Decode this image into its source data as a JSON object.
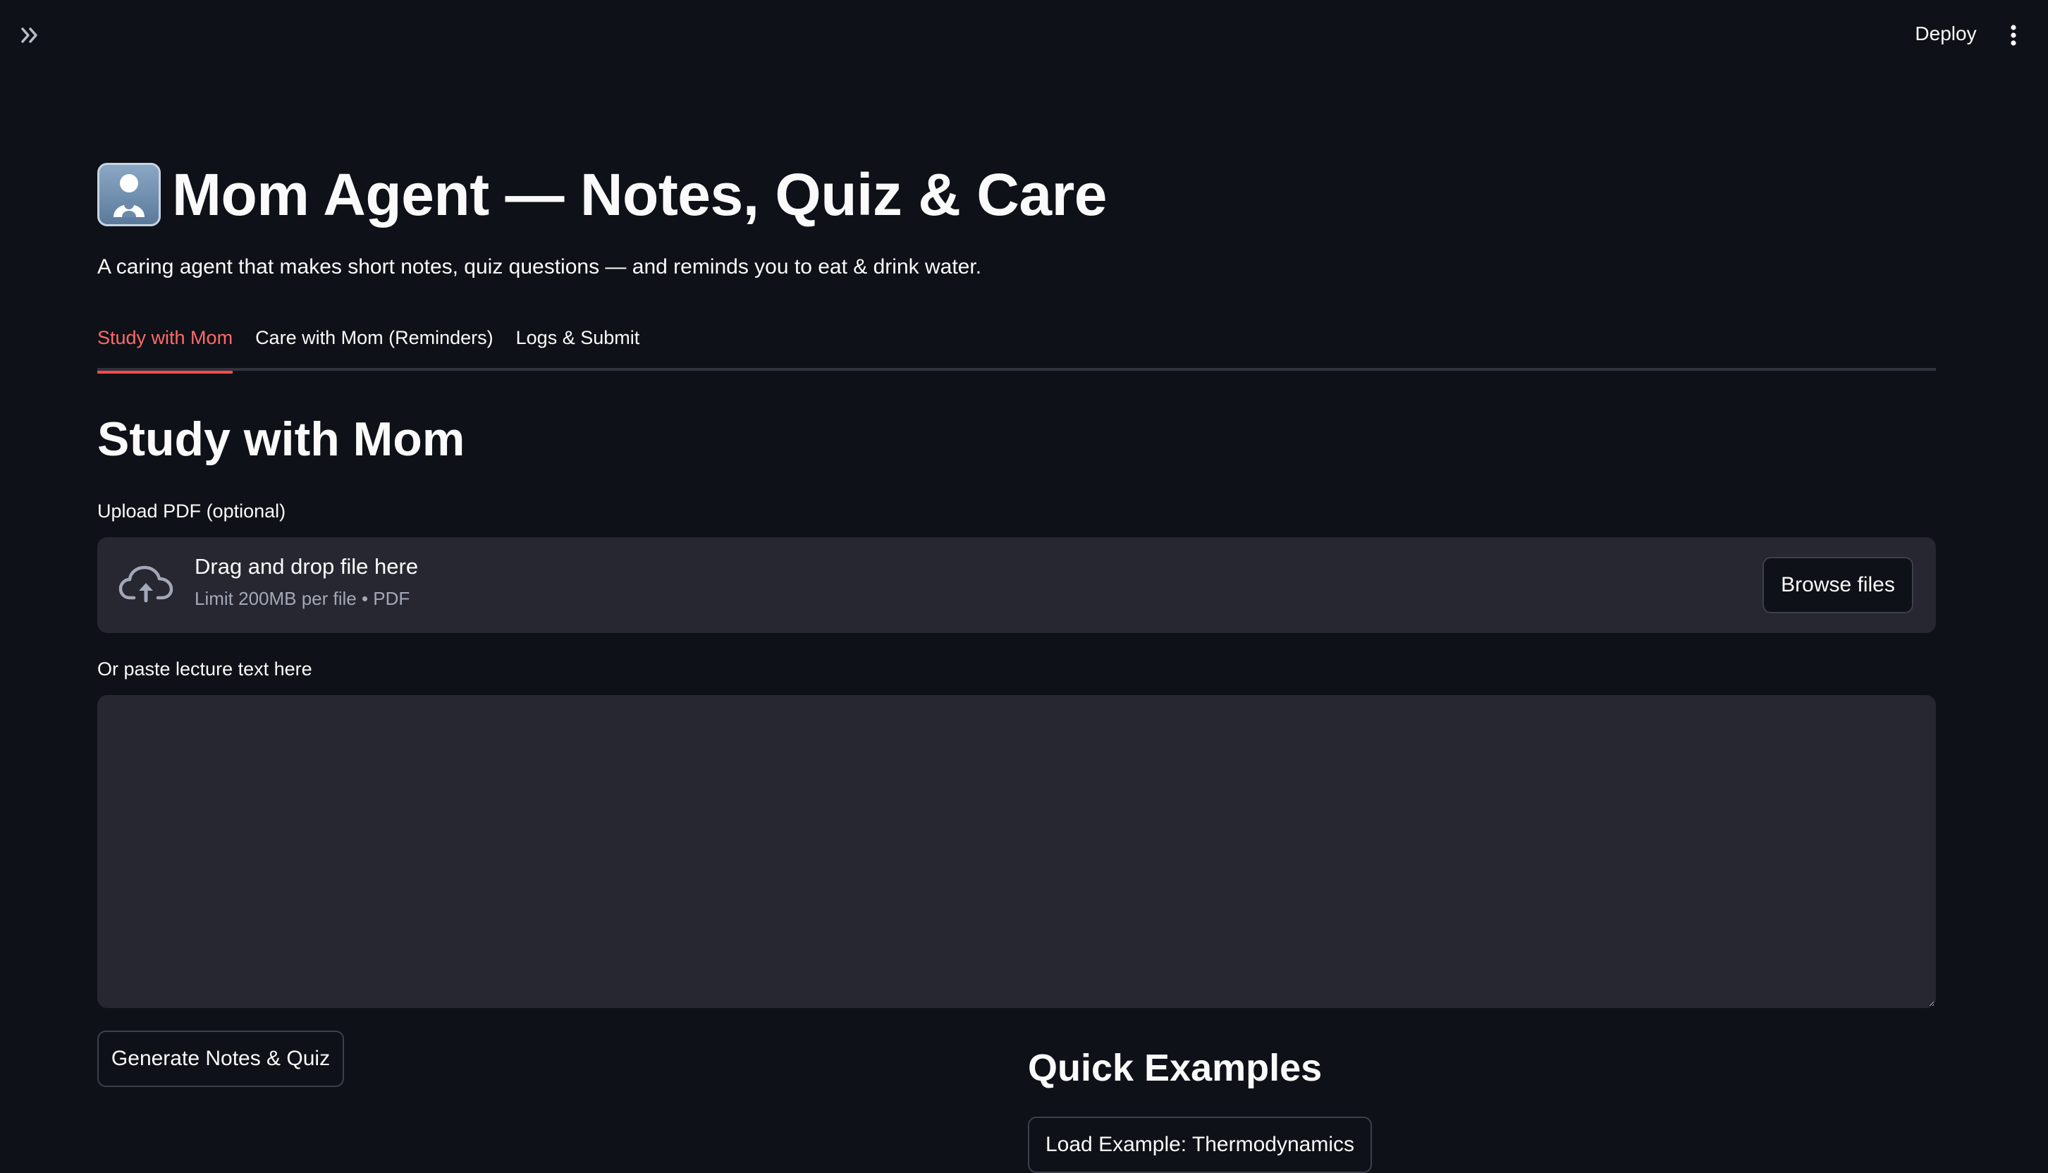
{
  "header": {
    "expand_icon": "double-chevron-right-icon",
    "deploy_label": "Deploy",
    "menu_icon": "vertical-dots-icon"
  },
  "page": {
    "title_emoji": "mother-with-baby-emoji",
    "title": "Mom Agent — Notes, Quiz & Care",
    "subtitle": "A caring agent that makes short notes, quiz questions — and reminds you to eat & drink water."
  },
  "tabs": [
    {
      "label": "Study with Mom",
      "active": true
    },
    {
      "label": "Care with Mom (Reminders)",
      "active": false
    },
    {
      "label": "Logs & Submit",
      "active": false
    }
  ],
  "study": {
    "section_title": "Study with Mom",
    "upload": {
      "label": "Upload PDF (optional)",
      "icon": "cloud-upload-icon",
      "drop_text": "Drag and drop file here",
      "limit_text": "Limit 200MB per file • PDF",
      "browse_label": "Browse files"
    },
    "lecture": {
      "label": "Or paste lecture text here",
      "value": ""
    },
    "generate_label": "Generate Notes & Quiz",
    "quick_examples": {
      "title": "Quick Examples",
      "load_example_label": "Load Example: Thermodynamics"
    }
  },
  "colors": {
    "background": "#0e1117",
    "surface": "#262730",
    "accent": "#ff4b4b",
    "text": "#fafafa",
    "muted_text": "#a3a8b8"
  }
}
